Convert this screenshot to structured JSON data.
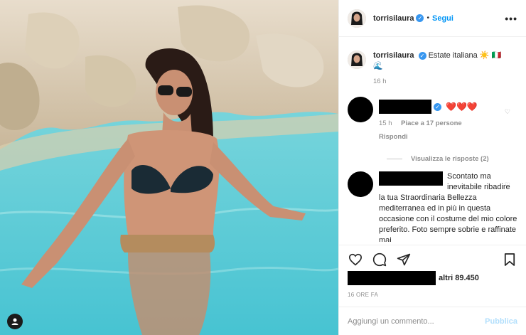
{
  "post": {
    "username": "torrisilaura",
    "follow_label": "Segui",
    "more_label": "•••",
    "verified_glyph": "✓",
    "separator": "•"
  },
  "caption": {
    "username": "torrisilaura",
    "text": "Estate italiana",
    "emojis": "☀️ 🇮🇹",
    "emoji2": "🌊",
    "time": "16 h"
  },
  "comments": [
    {
      "text": "❤️❤️❤️",
      "time": "15 h",
      "likes": "Piace a 17 persone",
      "reply": "Rispondi",
      "view_replies": "Visualizza le risposte (2)"
    },
    {
      "text": "Scontato ma inevitabile ribadire la tua Straordinaria Bellezza mediterranea ed in più in questa occasione con il costume del mio colore preferito. Foto sempre sobrie e raffinate mai"
    }
  ],
  "likes": {
    "others": "altri 89.450"
  },
  "timestamp": "16 ORE FA",
  "composer": {
    "placeholder": "Aggiungi un commento...",
    "publish_label": "Pubblica"
  },
  "colors": {
    "accent": "#0095f6",
    "verified": "#3897f0",
    "water": "#6fd1da"
  },
  "icons": {
    "like": "heart-icon",
    "comment": "comment-icon",
    "share": "share-icon",
    "save": "bookmark-icon",
    "tag": "user-tag-icon"
  }
}
